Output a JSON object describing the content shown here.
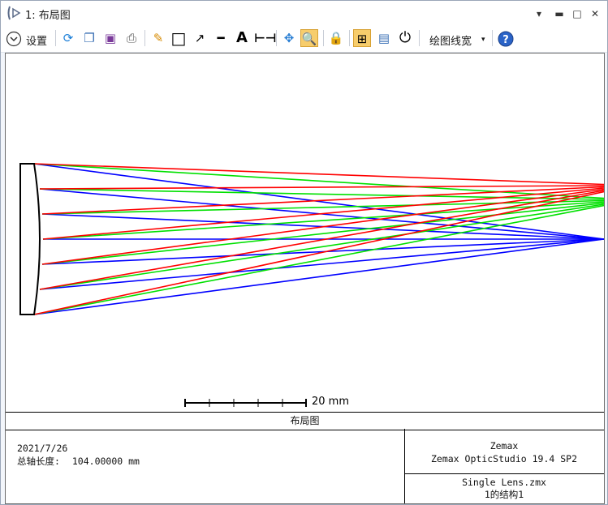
{
  "window": {
    "title": "1: 布局图",
    "controls": [
      "dropdown-icon",
      "minimize-icon",
      "maximize-icon",
      "close-icon"
    ]
  },
  "toolbar": {
    "settings_label": "设置",
    "line_width_label": "绘图线宽",
    "icons": [
      "refresh-icon",
      "copy-icon",
      "save-icon",
      "print-icon",
      "pencil-icon",
      "rectangle-icon",
      "arrow-icon",
      "line-icon",
      "text-icon",
      "dimension-icon",
      "pan-icon",
      "zoom-icon",
      "lock-icon",
      "fit-icon",
      "window-icon",
      "rotate-icon",
      "help-icon"
    ]
  },
  "plot": {
    "scale_label": "20 mm",
    "footer_title": "布局图",
    "date": "2021/7/26",
    "axis_length_label": "总轴长度:",
    "axis_length_value": "104.00000 mm",
    "company": "Zemax",
    "product": "Zemax OpticStudio 19.4 SP2",
    "file_name": "Single Lens.zmx",
    "config": "1的结构1",
    "colors": {
      "field1": "#0000ff",
      "field2": "#00e000",
      "field3": "#ff0000",
      "lens": "#000000"
    }
  }
}
